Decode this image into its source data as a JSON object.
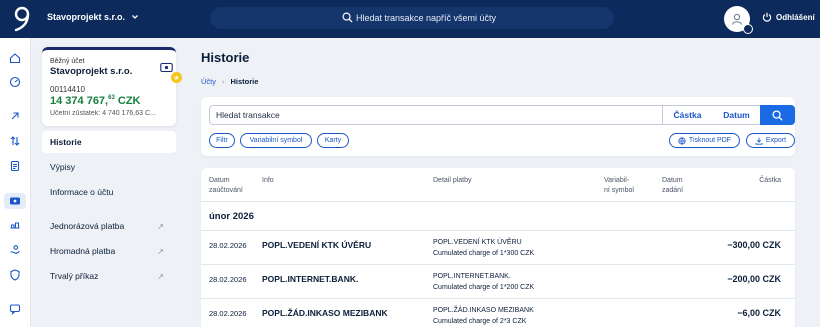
{
  "topbar": {
    "company": "Stavoprojekt s.r.o.",
    "search_placeholder": "Hledat transakce napříč všemi účty",
    "logout_label": "Odhlášení"
  },
  "account_card": {
    "type_label": "Běžný účet",
    "name": "Stavoprojekt s.r.o.",
    "number": "00114410",
    "balance_main": "14 374 767,",
    "balance_cents": "63",
    "balance_currency": " CZK",
    "ledger_balance": "Účetní zůstatek: 4 740 176,63 C..."
  },
  "side_menu": {
    "history": "Historie",
    "statements": "Výpisy",
    "account_info": "Informace o účtu",
    "single_payment": "Jednorázová platba",
    "bulk_payment": "Hromadná platba",
    "standing_order": "Trvalý příkaz"
  },
  "page": {
    "title": "Historie",
    "breadcrumb_accounts": "Účty",
    "breadcrumb_sep": "›",
    "breadcrumb_current": "Historie"
  },
  "filters": {
    "search_placeholder": "Hledat transakce",
    "amount_label": "Částka",
    "date_label": "Datum",
    "chips": [
      "Filtr",
      "Variabilní symbol",
      "Karty"
    ],
    "print_pdf": "Tisknout PDF",
    "export": "Export"
  },
  "table": {
    "headers": {
      "booking_date_1": "Datum",
      "booking_date_2": "zaúčtování",
      "info": "Info",
      "detail": "Detail platby",
      "vs_1": "Variabil-",
      "vs_2": "ní symbol",
      "entry_date_1": "Datum",
      "entry_date_2": "zadání",
      "amount": "Částka"
    },
    "month": "únor 2026",
    "rows": [
      {
        "date": "28.02.2026",
        "info": "POPL.VEDENÍ KTK ÚVĚRU",
        "detail_1": "POPL.VEDENÍ KTK ÚVĚRU",
        "detail_2": "Cumulated charge of 1*300 CZK",
        "amount": "−300,00 CZK"
      },
      {
        "date": "28.02.2026",
        "info": "POPL.INTERNET.BANK.",
        "detail_1": "POPL.INTERNET.BANK.",
        "detail_2": "Cumulated charge of 1*200 CZK",
        "amount": "−200,00 CZK"
      },
      {
        "date": "28.02.2026",
        "info": "POPL.ŽÁD.INKASO MEZIBANK",
        "detail_1": "POPL.ŽÁD.INKASO MEZIBANK",
        "detail_2": "Cumulated charge of 2*3 CZK",
        "amount": "−6,00 CZK"
      }
    ]
  },
  "colors": {
    "topbar": "#0c2a5b",
    "accent": "#1a56c8",
    "balance": "#15803d"
  }
}
